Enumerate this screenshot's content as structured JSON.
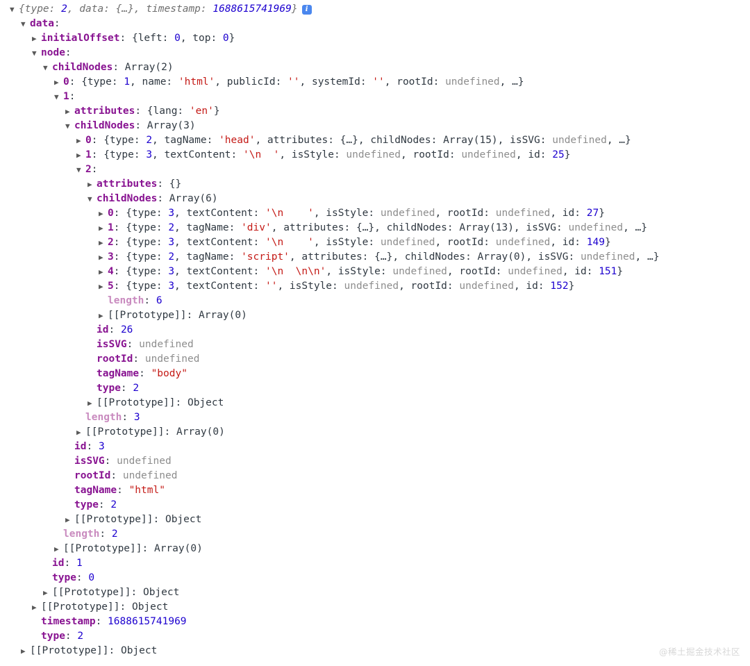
{
  "console": {
    "info_icon_label": "i",
    "watermark": "@稀土掘金技术社区",
    "rows": [
      {
        "depth": 0,
        "tri": "open",
        "segments": [
          {
            "t": "{type: ",
            "c": "preview"
          },
          {
            "t": "2",
            "c": "preview-num"
          },
          {
            "t": ", data: {…}, timestamp: ",
            "c": "preview"
          },
          {
            "t": "1688615741969",
            "c": "preview-num"
          },
          {
            "t": "}",
            "c": "preview"
          }
        ],
        "badge": true
      },
      {
        "depth": 1,
        "tri": "open",
        "segments": [
          {
            "t": "data",
            "c": "key"
          },
          {
            "t": ":",
            "c": "punct"
          }
        ]
      },
      {
        "depth": 2,
        "tri": "closed",
        "segments": [
          {
            "t": "initialOffset",
            "c": "key"
          },
          {
            "t": ": {left: ",
            "c": "plain"
          },
          {
            "t": "0",
            "c": "num"
          },
          {
            "t": ", top: ",
            "c": "plain"
          },
          {
            "t": "0",
            "c": "num"
          },
          {
            "t": "}",
            "c": "plain"
          }
        ]
      },
      {
        "depth": 2,
        "tri": "open",
        "segments": [
          {
            "t": "node",
            "c": "key"
          },
          {
            "t": ":",
            "c": "punct"
          }
        ]
      },
      {
        "depth": 3,
        "tri": "open",
        "segments": [
          {
            "t": "childNodes",
            "c": "key"
          },
          {
            "t": ": Array(2)",
            "c": "plain"
          }
        ]
      },
      {
        "depth": 4,
        "tri": "closed",
        "segments": [
          {
            "t": "0",
            "c": "key"
          },
          {
            "t": ": {type: ",
            "c": "plain"
          },
          {
            "t": "1",
            "c": "num"
          },
          {
            "t": ", name: ",
            "c": "plain"
          },
          {
            "t": "'html'",
            "c": "str"
          },
          {
            "t": ", publicId: ",
            "c": "plain"
          },
          {
            "t": "''",
            "c": "str"
          },
          {
            "t": ", systemId: ",
            "c": "plain"
          },
          {
            "t": "''",
            "c": "str"
          },
          {
            "t": ", rootId: ",
            "c": "plain"
          },
          {
            "t": "undefined",
            "c": "undef"
          },
          {
            "t": ", …}",
            "c": "plain"
          }
        ]
      },
      {
        "depth": 4,
        "tri": "open",
        "segments": [
          {
            "t": "1",
            "c": "key"
          },
          {
            "t": ":",
            "c": "punct"
          }
        ]
      },
      {
        "depth": 5,
        "tri": "closed",
        "segments": [
          {
            "t": "attributes",
            "c": "key"
          },
          {
            "t": ": {lang: ",
            "c": "plain"
          },
          {
            "t": "'en'",
            "c": "str"
          },
          {
            "t": "}",
            "c": "plain"
          }
        ]
      },
      {
        "depth": 5,
        "tri": "open",
        "segments": [
          {
            "t": "childNodes",
            "c": "key"
          },
          {
            "t": ": Array(3)",
            "c": "plain"
          }
        ]
      },
      {
        "depth": 6,
        "tri": "closed",
        "segments": [
          {
            "t": "0",
            "c": "key"
          },
          {
            "t": ": {type: ",
            "c": "plain"
          },
          {
            "t": "2",
            "c": "num"
          },
          {
            "t": ", tagName: ",
            "c": "plain"
          },
          {
            "t": "'head'",
            "c": "str"
          },
          {
            "t": ", attributes: {…}, childNodes: Array(15), isSVG: ",
            "c": "plain"
          },
          {
            "t": "undefined",
            "c": "undef"
          },
          {
            "t": ", …}",
            "c": "plain"
          }
        ]
      },
      {
        "depth": 6,
        "tri": "closed",
        "segments": [
          {
            "t": "1",
            "c": "key"
          },
          {
            "t": ": {type: ",
            "c": "plain"
          },
          {
            "t": "3",
            "c": "num"
          },
          {
            "t": ", textContent: ",
            "c": "plain"
          },
          {
            "t": "'\\n  '",
            "c": "str"
          },
          {
            "t": ", isStyle: ",
            "c": "plain"
          },
          {
            "t": "undefined",
            "c": "undef"
          },
          {
            "t": ", rootId: ",
            "c": "plain"
          },
          {
            "t": "undefined",
            "c": "undef"
          },
          {
            "t": ", id: ",
            "c": "plain"
          },
          {
            "t": "25",
            "c": "num"
          },
          {
            "t": "}",
            "c": "plain"
          }
        ]
      },
      {
        "depth": 6,
        "tri": "open",
        "segments": [
          {
            "t": "2",
            "c": "key"
          },
          {
            "t": ":",
            "c": "punct"
          }
        ]
      },
      {
        "depth": 7,
        "tri": "closed",
        "segments": [
          {
            "t": "attributes",
            "c": "key"
          },
          {
            "t": ": {}",
            "c": "plain"
          }
        ]
      },
      {
        "depth": 7,
        "tri": "open",
        "segments": [
          {
            "t": "childNodes",
            "c": "key"
          },
          {
            "t": ": Array(6)",
            "c": "plain"
          }
        ]
      },
      {
        "depth": 8,
        "tri": "closed",
        "segments": [
          {
            "t": "0",
            "c": "key"
          },
          {
            "t": ": {type: ",
            "c": "plain"
          },
          {
            "t": "3",
            "c": "num"
          },
          {
            "t": ", textContent: ",
            "c": "plain"
          },
          {
            "t": "'\\n    '",
            "c": "str"
          },
          {
            "t": ", isStyle: ",
            "c": "plain"
          },
          {
            "t": "undefined",
            "c": "undef"
          },
          {
            "t": ", rootId: ",
            "c": "plain"
          },
          {
            "t": "undefined",
            "c": "undef"
          },
          {
            "t": ", id: ",
            "c": "plain"
          },
          {
            "t": "27",
            "c": "num"
          },
          {
            "t": "}",
            "c": "plain"
          }
        ]
      },
      {
        "depth": 8,
        "tri": "closed",
        "segments": [
          {
            "t": "1",
            "c": "key"
          },
          {
            "t": ": {type: ",
            "c": "plain"
          },
          {
            "t": "2",
            "c": "num"
          },
          {
            "t": ", tagName: ",
            "c": "plain"
          },
          {
            "t": "'div'",
            "c": "str"
          },
          {
            "t": ", attributes: {…}, childNodes: Array(13), isSVG: ",
            "c": "plain"
          },
          {
            "t": "undefined",
            "c": "undef"
          },
          {
            "t": ", …}",
            "c": "plain"
          }
        ]
      },
      {
        "depth": 8,
        "tri": "closed",
        "segments": [
          {
            "t": "2",
            "c": "key"
          },
          {
            "t": ": {type: ",
            "c": "plain"
          },
          {
            "t": "3",
            "c": "num"
          },
          {
            "t": ", textContent: ",
            "c": "plain"
          },
          {
            "t": "'\\n    '",
            "c": "str"
          },
          {
            "t": ", isStyle: ",
            "c": "plain"
          },
          {
            "t": "undefined",
            "c": "undef"
          },
          {
            "t": ", rootId: ",
            "c": "plain"
          },
          {
            "t": "undefined",
            "c": "undef"
          },
          {
            "t": ", id: ",
            "c": "plain"
          },
          {
            "t": "149",
            "c": "num"
          },
          {
            "t": "}",
            "c": "plain"
          }
        ]
      },
      {
        "depth": 8,
        "tri": "closed",
        "segments": [
          {
            "t": "3",
            "c": "key"
          },
          {
            "t": ": {type: ",
            "c": "plain"
          },
          {
            "t": "2",
            "c": "num"
          },
          {
            "t": ", tagName: ",
            "c": "plain"
          },
          {
            "t": "'script'",
            "c": "str"
          },
          {
            "t": ", attributes: {…}, childNodes: Array(0), isSVG: ",
            "c": "plain"
          },
          {
            "t": "undefined",
            "c": "undef"
          },
          {
            "t": ", …}",
            "c": "plain"
          }
        ]
      },
      {
        "depth": 8,
        "tri": "closed",
        "segments": [
          {
            "t": "4",
            "c": "key"
          },
          {
            "t": ": {type: ",
            "c": "plain"
          },
          {
            "t": "3",
            "c": "num"
          },
          {
            "t": ", textContent: ",
            "c": "plain"
          },
          {
            "t": "'\\n  \\n\\n'",
            "c": "str"
          },
          {
            "t": ", isStyle: ",
            "c": "plain"
          },
          {
            "t": "undefined",
            "c": "undef"
          },
          {
            "t": ", rootId: ",
            "c": "plain"
          },
          {
            "t": "undefined",
            "c": "undef"
          },
          {
            "t": ", id: ",
            "c": "plain"
          },
          {
            "t": "151",
            "c": "num"
          },
          {
            "t": "}",
            "c": "plain"
          }
        ]
      },
      {
        "depth": 8,
        "tri": "closed",
        "segments": [
          {
            "t": "5",
            "c": "key"
          },
          {
            "t": ": {type: ",
            "c": "plain"
          },
          {
            "t": "3",
            "c": "num"
          },
          {
            "t": ", textContent: ",
            "c": "plain"
          },
          {
            "t": "''",
            "c": "str"
          },
          {
            "t": ", isStyle: ",
            "c": "plain"
          },
          {
            "t": "undefined",
            "c": "undef"
          },
          {
            "t": ", rootId: ",
            "c": "plain"
          },
          {
            "t": "undefined",
            "c": "undef"
          },
          {
            "t": ", id: ",
            "c": "plain"
          },
          {
            "t": "152",
            "c": "num"
          },
          {
            "t": "}",
            "c": "plain"
          }
        ]
      },
      {
        "depth": 8,
        "tri": "none",
        "segments": [
          {
            "t": "length",
            "c": "key-light"
          },
          {
            "t": ": ",
            "c": "plain"
          },
          {
            "t": "6",
            "c": "num"
          }
        ]
      },
      {
        "depth": 8,
        "tri": "closed",
        "segments": [
          {
            "t": "[[Prototype]]",
            "c": "proto"
          },
          {
            "t": ": Array(0)",
            "c": "plain"
          }
        ]
      },
      {
        "depth": 7,
        "tri": "none",
        "segments": [
          {
            "t": "id",
            "c": "key"
          },
          {
            "t": ": ",
            "c": "plain"
          },
          {
            "t": "26",
            "c": "num"
          }
        ]
      },
      {
        "depth": 7,
        "tri": "none",
        "segments": [
          {
            "t": "isSVG",
            "c": "key"
          },
          {
            "t": ": ",
            "c": "plain"
          },
          {
            "t": "undefined",
            "c": "undef"
          }
        ]
      },
      {
        "depth": 7,
        "tri": "none",
        "segments": [
          {
            "t": "rootId",
            "c": "key"
          },
          {
            "t": ": ",
            "c": "plain"
          },
          {
            "t": "undefined",
            "c": "undef"
          }
        ]
      },
      {
        "depth": 7,
        "tri": "none",
        "segments": [
          {
            "t": "tagName",
            "c": "key"
          },
          {
            "t": ": ",
            "c": "plain"
          },
          {
            "t": "\"body\"",
            "c": "str"
          }
        ]
      },
      {
        "depth": 7,
        "tri": "none",
        "segments": [
          {
            "t": "type",
            "c": "key"
          },
          {
            "t": ": ",
            "c": "plain"
          },
          {
            "t": "2",
            "c": "num"
          }
        ]
      },
      {
        "depth": 7,
        "tri": "closed",
        "segments": [
          {
            "t": "[[Prototype]]",
            "c": "proto"
          },
          {
            "t": ": Object",
            "c": "plain"
          }
        ]
      },
      {
        "depth": 6,
        "tri": "none",
        "segments": [
          {
            "t": "length",
            "c": "key-light"
          },
          {
            "t": ": ",
            "c": "plain"
          },
          {
            "t": "3",
            "c": "num"
          }
        ]
      },
      {
        "depth": 6,
        "tri": "closed",
        "segments": [
          {
            "t": "[[Prototype]]",
            "c": "proto"
          },
          {
            "t": ": Array(0)",
            "c": "plain"
          }
        ]
      },
      {
        "depth": 5,
        "tri": "none",
        "segments": [
          {
            "t": "id",
            "c": "key"
          },
          {
            "t": ": ",
            "c": "plain"
          },
          {
            "t": "3",
            "c": "num"
          }
        ]
      },
      {
        "depth": 5,
        "tri": "none",
        "segments": [
          {
            "t": "isSVG",
            "c": "key"
          },
          {
            "t": ": ",
            "c": "plain"
          },
          {
            "t": "undefined",
            "c": "undef"
          }
        ]
      },
      {
        "depth": 5,
        "tri": "none",
        "segments": [
          {
            "t": "rootId",
            "c": "key"
          },
          {
            "t": ": ",
            "c": "plain"
          },
          {
            "t": "undefined",
            "c": "undef"
          }
        ]
      },
      {
        "depth": 5,
        "tri": "none",
        "segments": [
          {
            "t": "tagName",
            "c": "key"
          },
          {
            "t": ": ",
            "c": "plain"
          },
          {
            "t": "\"html\"",
            "c": "str"
          }
        ]
      },
      {
        "depth": 5,
        "tri": "none",
        "segments": [
          {
            "t": "type",
            "c": "key"
          },
          {
            "t": ": ",
            "c": "plain"
          },
          {
            "t": "2",
            "c": "num"
          }
        ]
      },
      {
        "depth": 5,
        "tri": "closed",
        "segments": [
          {
            "t": "[[Prototype]]",
            "c": "proto"
          },
          {
            "t": ": Object",
            "c": "plain"
          }
        ]
      },
      {
        "depth": 4,
        "tri": "none",
        "segments": [
          {
            "t": "length",
            "c": "key-light"
          },
          {
            "t": ": ",
            "c": "plain"
          },
          {
            "t": "2",
            "c": "num"
          }
        ]
      },
      {
        "depth": 4,
        "tri": "closed",
        "segments": [
          {
            "t": "[[Prototype]]",
            "c": "proto"
          },
          {
            "t": ": Array(0)",
            "c": "plain"
          }
        ]
      },
      {
        "depth": 3,
        "tri": "none",
        "segments": [
          {
            "t": "id",
            "c": "key"
          },
          {
            "t": ": ",
            "c": "plain"
          },
          {
            "t": "1",
            "c": "num"
          }
        ]
      },
      {
        "depth": 3,
        "tri": "none",
        "segments": [
          {
            "t": "type",
            "c": "key"
          },
          {
            "t": ": ",
            "c": "plain"
          },
          {
            "t": "0",
            "c": "num"
          }
        ]
      },
      {
        "depth": 3,
        "tri": "closed",
        "segments": [
          {
            "t": "[[Prototype]]",
            "c": "proto"
          },
          {
            "t": ": Object",
            "c": "plain"
          }
        ]
      },
      {
        "depth": 2,
        "tri": "closed",
        "segments": [
          {
            "t": "[[Prototype]]",
            "c": "proto"
          },
          {
            "t": ": Object",
            "c": "plain"
          }
        ]
      },
      {
        "depth": 2,
        "tri": "none",
        "segments": [
          {
            "t": "timestamp",
            "c": "key"
          },
          {
            "t": ": ",
            "c": "plain"
          },
          {
            "t": "1688615741969",
            "c": "num"
          }
        ]
      },
      {
        "depth": 2,
        "tri": "none",
        "segments": [
          {
            "t": "type",
            "c": "key"
          },
          {
            "t": ": ",
            "c": "plain"
          },
          {
            "t": "2",
            "c": "num"
          }
        ]
      },
      {
        "depth": 1,
        "tri": "closed",
        "segments": [
          {
            "t": "[[Prototype]]",
            "c": "proto"
          },
          {
            "t": ": Object",
            "c": "plain"
          }
        ]
      }
    ]
  }
}
